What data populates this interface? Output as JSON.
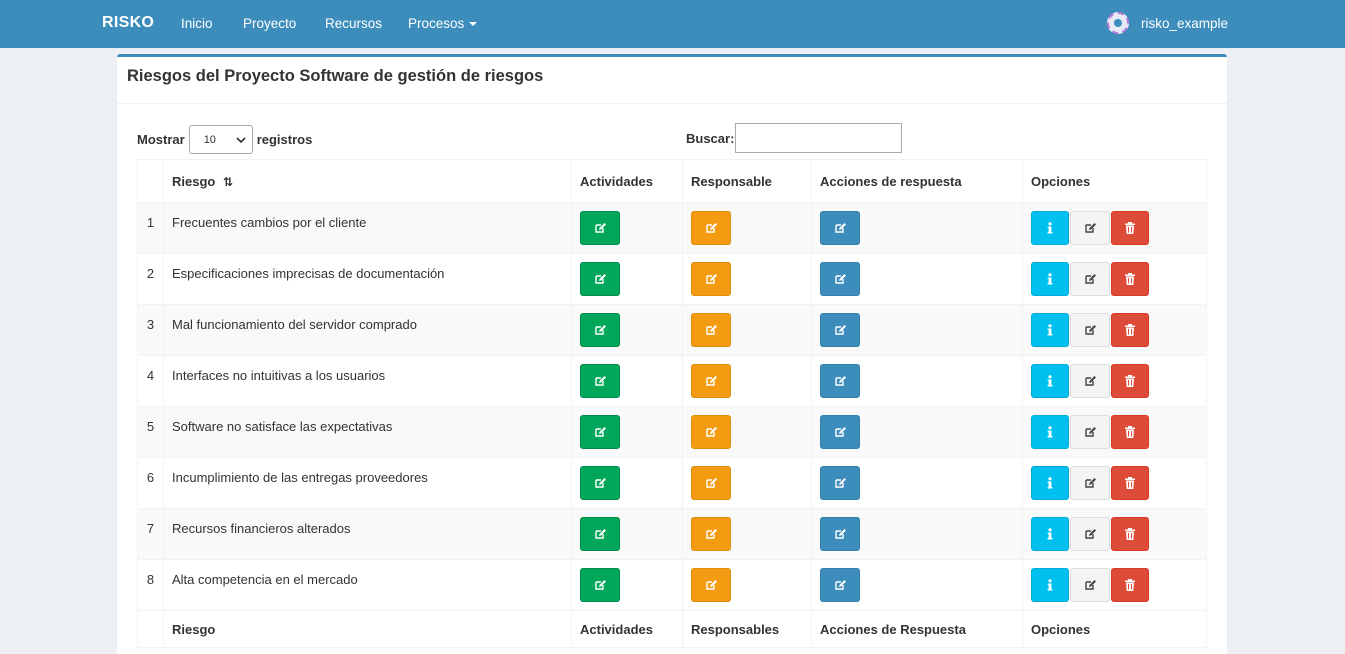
{
  "navbar": {
    "brand": "RISKO",
    "items": [
      "Inicio",
      "Proyecto",
      "Recursos",
      "Procesos"
    ],
    "user": "risko_example"
  },
  "box": {
    "title": "Riesgos del Proyecto Software de gestión de riesgos"
  },
  "controls": {
    "show_label": "Mostrar",
    "show_value": "10",
    "records_label": "registros",
    "search_label": "Buscar:",
    "search_value": ""
  },
  "table": {
    "headers": [
      "Riesgo",
      "Actividades",
      "Responsable",
      "Acciones de respuesta",
      "Opciones"
    ],
    "footers": [
      "Riesgo",
      "Actividades",
      "Responsables",
      "Acciones de Respuesta",
      "Opciones"
    ],
    "rows": [
      {
        "num": "1",
        "risk": "Frecuentes cambios por el cliente"
      },
      {
        "num": "2",
        "risk": "Especificaciones imprecisas de documentación"
      },
      {
        "num": "3",
        "risk": "Mal funcionamiento del servidor comprado"
      },
      {
        "num": "4",
        "risk": "Interfaces no intuitivas a los usuarios"
      },
      {
        "num": "5",
        "risk": "Software no satisface las expectativas"
      },
      {
        "num": "6",
        "risk": "Incumplimiento de las entregas proveedores"
      },
      {
        "num": "7",
        "risk": "Recursos financieros alterados"
      },
      {
        "num": "8",
        "risk": "Alta competencia en el mercado"
      }
    ]
  },
  "colors": {
    "primary": "#3c8dbc",
    "green": "#00a65a",
    "orange": "#f39c12",
    "aqua": "#00c0ef",
    "red": "#dd4b39"
  },
  "icons": {
    "edit": "edit-icon",
    "info": "info-icon",
    "delete": "trash-icon",
    "sort": "sort-icon"
  }
}
